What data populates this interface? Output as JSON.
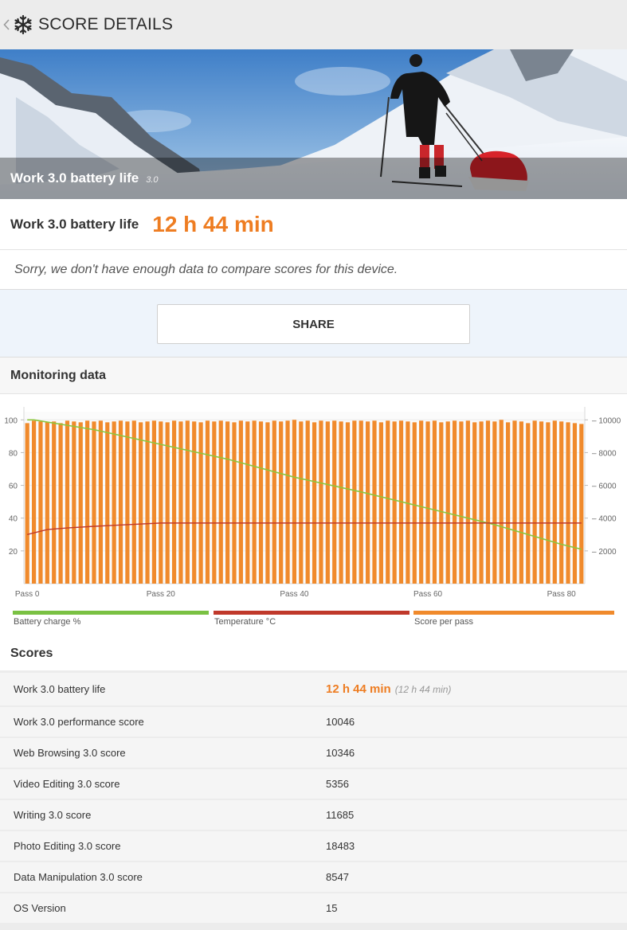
{
  "topbar": {
    "back_icon": "chevron-left-icon",
    "logo_icon": "snowflake-icon",
    "title": "SCORE DETAILS"
  },
  "hero": {
    "title": "Work 3.0 battery life",
    "version": "3.0"
  },
  "score_card": {
    "label": "Work 3.0 battery life",
    "value": "12 h 44 min"
  },
  "compare_note": "Sorry, we don't have enough data to compare scores for this device.",
  "share_label": "SHARE",
  "monitoring_title": "Monitoring data",
  "chart_data": {
    "type": "bar",
    "x_tick_labels": [
      "Pass 0",
      "Pass 20",
      "Pass 40",
      "Pass 60",
      "Pass 80"
    ],
    "x_ticks": [
      0,
      20,
      40,
      60,
      80
    ],
    "xlim": [
      -0.5,
      83.5
    ],
    "left_axis": {
      "ticks": [
        20,
        40,
        60,
        80,
        100
      ],
      "ylim": [
        0,
        105
      ]
    },
    "right_axis": {
      "ticks": [
        2000,
        4000,
        6000,
        8000,
        10000
      ],
      "ylim": [
        0,
        10500
      ]
    },
    "score_per_pass": [
      9800,
      9950,
      9900,
      9850,
      9900,
      9800,
      9950,
      9900,
      9850,
      9950,
      9900,
      9950,
      9850,
      9900,
      9950,
      9900,
      9950,
      9850,
      9900,
      9950,
      9900,
      9850,
      9950,
      9900,
      9950,
      9900,
      9850,
      9950,
      9900,
      9950,
      9900,
      9850,
      9950,
      9900,
      9950,
      9900,
      9850,
      9950,
      9900,
      9950,
      10000,
      9900,
      9950,
      9850,
      9950,
      9900,
      9950,
      9900,
      9850,
      9950,
      9950,
      9900,
      9950,
      9850,
      9950,
      9900,
      9950,
      9900,
      9850,
      9950,
      9900,
      9950,
      9850,
      9900,
      9950,
      9900,
      9950,
      9850,
      9900,
      9950,
      9900,
      10000,
      9850,
      9950,
      9900,
      9800,
      9950,
      9900,
      9850,
      9950,
      9900,
      9850,
      9800,
      9750
    ],
    "battery_charge": [
      [
        0,
        100
      ],
      [
        1,
        100
      ],
      [
        10,
        94
      ],
      [
        20,
        85
      ],
      [
        30,
        76
      ],
      [
        40,
        65
      ],
      [
        50,
        56
      ],
      [
        60,
        46
      ],
      [
        70,
        36
      ],
      [
        80,
        24
      ],
      [
        83,
        21
      ]
    ],
    "temperature": [
      [
        0,
        30
      ],
      [
        3,
        33
      ],
      [
        6,
        34
      ],
      [
        10,
        35
      ],
      [
        15,
        36
      ],
      [
        20,
        37
      ],
      [
        30,
        37
      ],
      [
        40,
        37
      ],
      [
        50,
        37
      ],
      [
        60,
        37
      ],
      [
        70,
        37
      ],
      [
        83,
        37
      ]
    ],
    "legend": [
      {
        "name": "Battery charge %",
        "color": "#7ac143"
      },
      {
        "name": "Temperature °C",
        "color": "#c0392b"
      },
      {
        "name": "Score per pass",
        "color": "#f08a2c"
      }
    ],
    "grid": true
  },
  "scores_title": "Scores",
  "scores": [
    {
      "name": "Work 3.0 battery life",
      "value": "12 h 44 min",
      "sub": "(12 h 44 min)"
    },
    {
      "name": "Work 3.0 performance score",
      "value": "10046"
    },
    {
      "name": "Web Browsing 3.0 score",
      "value": "10346"
    },
    {
      "name": "Video Editing 3.0 score",
      "value": "5356"
    },
    {
      "name": "Writing 3.0 score",
      "value": "11685"
    },
    {
      "name": "Photo Editing 3.0 score",
      "value": "18483"
    },
    {
      "name": "Data Manipulation 3.0 score",
      "value": "8547"
    },
    {
      "name": "OS Version",
      "value": "15"
    }
  ]
}
